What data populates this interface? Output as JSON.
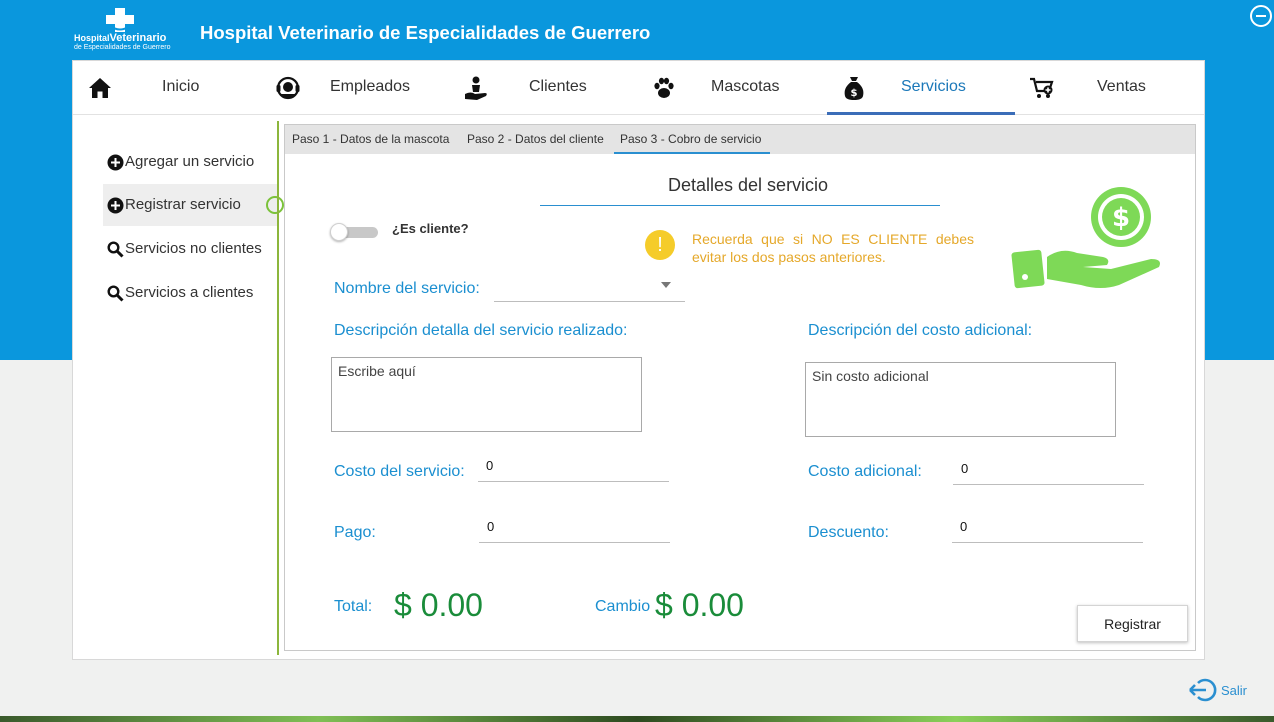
{
  "app": {
    "title": "Hospital Veterinario de Especialidades de Guerrero",
    "logo_line1_small": "Hospital",
    "logo_line1_big": "Veterinario",
    "logo_line2": "de Especialidades de Guerrero"
  },
  "nav": {
    "items": [
      {
        "label": "Inicio",
        "icon": "home-icon"
      },
      {
        "label": "Empleados",
        "icon": "headset-user-icon"
      },
      {
        "label": "Clientes",
        "icon": "client-hand-icon"
      },
      {
        "label": "Mascotas",
        "icon": "paw-icon"
      },
      {
        "label": "Servicios",
        "icon": "money-bag-icon",
        "active": true
      },
      {
        "label": "Ventas",
        "icon": "cart-add-icon"
      }
    ]
  },
  "sidebar": {
    "items": [
      {
        "label": "Agregar un servicio",
        "icon": "plus-circle-icon"
      },
      {
        "label": "Registrar servicio",
        "icon": "plus-circle-icon",
        "active": true
      },
      {
        "label": "Servicios no clientes",
        "icon": "search-icon"
      },
      {
        "label": "Servicios a clientes",
        "icon": "search-icon"
      }
    ]
  },
  "tabs": [
    {
      "label": "Paso 1 - Datos de la mascota"
    },
    {
      "label": "Paso 2 - Datos del cliente"
    },
    {
      "label": "Paso 3 - Cobro de servicio",
      "active": true
    }
  ],
  "form": {
    "section_title": "Detalles del servicio",
    "is_client_label": "¿Es cliente?",
    "is_client_on": false,
    "warning": "Recuerda que si NO ES CLIENTE debes evitar los  dos pasos anteriores.",
    "service_name_label": "Nombre del servicio:",
    "service_name_value": "",
    "description_label": "Descripción detalla del servicio realizado:",
    "description_placeholder": "Escribe aquí",
    "extra_cost_desc_label": "Descripción del costo adicional:",
    "extra_cost_desc_placeholder": "Sin costo adicional",
    "service_cost_label": "Costo del servicio:",
    "service_cost_value": "0",
    "extra_cost_label": "Costo adicional:",
    "extra_cost_value": "0",
    "payment_label": "Pago:",
    "payment_value": "0",
    "discount_label": "Descuento:",
    "discount_value": "0",
    "total_label": "Total:",
    "total_value": "$ 0.00",
    "change_label": "Cambio",
    "change_value": "$ 0.00",
    "register_button": "Registrar"
  },
  "exit": {
    "label": "Salir"
  },
  "colors": {
    "header_blue": "#0a97dd",
    "accent_blue": "#1b8fd0",
    "money_green": "#1a8c3a",
    "warning_yellow": "#f5cc2a",
    "illustration_green": "#7ed957"
  }
}
